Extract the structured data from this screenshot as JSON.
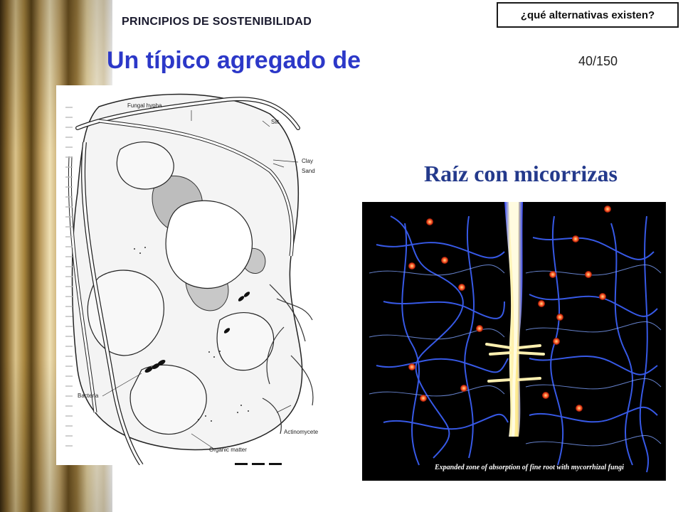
{
  "header": {
    "section_label": "PRINCIPIOS DE SOSTENIBILIDAD",
    "question_button": "¿qué alternativas existen?",
    "page_number": "40/150"
  },
  "title": "Un típico agregado de",
  "figure_left": {
    "labels": {
      "fungal_hypha": "Fungal hypha",
      "silt": "Silt",
      "clay": "Clay",
      "sand": "Sand",
      "bacteria": "Bacteria",
      "actinomycete": "Actinomycete",
      "organic_matter": "Organic matter"
    }
  },
  "figure_right": {
    "title": "Raíz con micorrizas",
    "caption": "Expanded zone of absorption of fine root with mycorrhizal fungi"
  },
  "colors": {
    "title_blue": "#2c38c8",
    "subtitle_blue": "#243a8c",
    "fungal_network": "#3a5cff",
    "root": "#fff2a0",
    "spores": "#ff5a2a"
  }
}
